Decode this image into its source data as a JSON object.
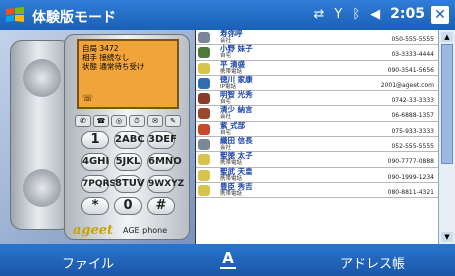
{
  "titlebar": {
    "title": "体験版モード",
    "time": "2:05",
    "close": "✕",
    "status_icons": [
      "connectivity-icon",
      "signal-icon",
      "bluetooth-icon",
      "volume-icon"
    ]
  },
  "phone": {
    "lcd_lines": [
      "自局 3472",
      "相手 接続なし",
      "状態 通常待ち受け"
    ],
    "function_keys": [
      "✆",
      "☎",
      "◎",
      "⏱",
      "✉",
      "✎"
    ],
    "keypad": [
      "1",
      "2ABC",
      "3DEF",
      "4GHI",
      "5JKL",
      "6MNO",
      "7PQRS",
      "8TUV",
      "9WXYZ",
      "*",
      "0",
      "#"
    ],
    "brand_logo": "ageet",
    "brand_name": "AGE phone"
  },
  "contacts": [
    {
      "name": "寿弥呼",
      "category": "会社",
      "number": "050-555-5555",
      "icon_color": "#7a8796"
    },
    {
      "name": "小野 妹子",
      "category": "自宅",
      "number": "03-3333-4444",
      "icon_color": "#4f7a3a"
    },
    {
      "name": "平 清盛",
      "category": "携帯電話",
      "number": "090-3541-5656",
      "icon_color": "#d7c44a"
    },
    {
      "name": "徳川 家康",
      "category": "IP電話",
      "number": "2001@ageet.com",
      "icon_color": "#2f6fb0"
    },
    {
      "name": "明智 光秀",
      "category": "自宅",
      "number": "0742-33-3333",
      "icon_color": "#8c3a2a"
    },
    {
      "name": "清少 納言",
      "category": "会社",
      "number": "06-6888-1357",
      "icon_color": "#9a4a2a"
    },
    {
      "name": "紫 式部",
      "category": "自宅",
      "number": "075-933-3333",
      "icon_color": "#c54a2a"
    },
    {
      "name": "織田 信長",
      "category": "会社",
      "number": "052-555-5555",
      "icon_color": "#7a8796"
    },
    {
      "name": "聖徳 太子",
      "category": "携帯電話",
      "number": "090-7777-0888",
      "icon_color": "#d7c44a"
    },
    {
      "name": "聖武 天皇",
      "category": "携帯電話",
      "number": "090-1999-1234",
      "icon_color": "#d7c44a"
    },
    {
      "name": "豊臣 秀吉",
      "category": "携帯電話",
      "number": "080-8811-4321",
      "icon_color": "#d7c44a"
    }
  ],
  "menubar": {
    "left": "ファイル",
    "middle": "A",
    "right": "アドレス帳"
  }
}
